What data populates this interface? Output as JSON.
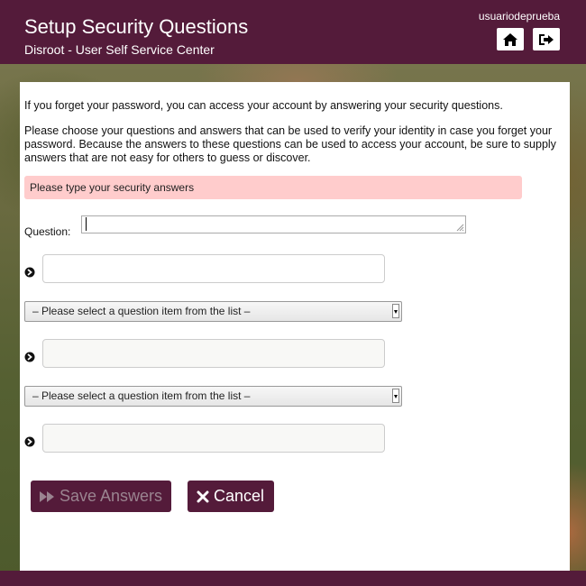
{
  "header": {
    "title": "Setup Security Questions",
    "subtitle": "Disroot - User Self Service Center",
    "username": "usuariodeprueba",
    "home_icon": "home-icon",
    "logout_icon": "sign-out-icon"
  },
  "intro": {
    "line1": "If you forget your password, you can access your account by answering your security questions.",
    "line2": "Please choose your questions and answers that can be used to verify your identity in case you forget your password. Because the answers to these questions can be used to access your account, be sure to supply answers that are not easy for others to guess or discover."
  },
  "alert": "Please type your security answers",
  "form": {
    "question_label": "Question:",
    "question_value": "",
    "questions": [
      {
        "select": null,
        "answer": "",
        "enabled": true
      },
      {
        "select": "– Please select a question item from the list –",
        "answer": "",
        "enabled": false
      },
      {
        "select": "– Please select a question item from the list –",
        "answer": "",
        "enabled": false
      }
    ]
  },
  "buttons": {
    "save": "Save Answers",
    "save_enabled": false,
    "cancel": "Cancel"
  },
  "colors": {
    "brand": "#541b3a",
    "alert_bg": "#ffcccc",
    "disabled_text": "#9a8490"
  }
}
